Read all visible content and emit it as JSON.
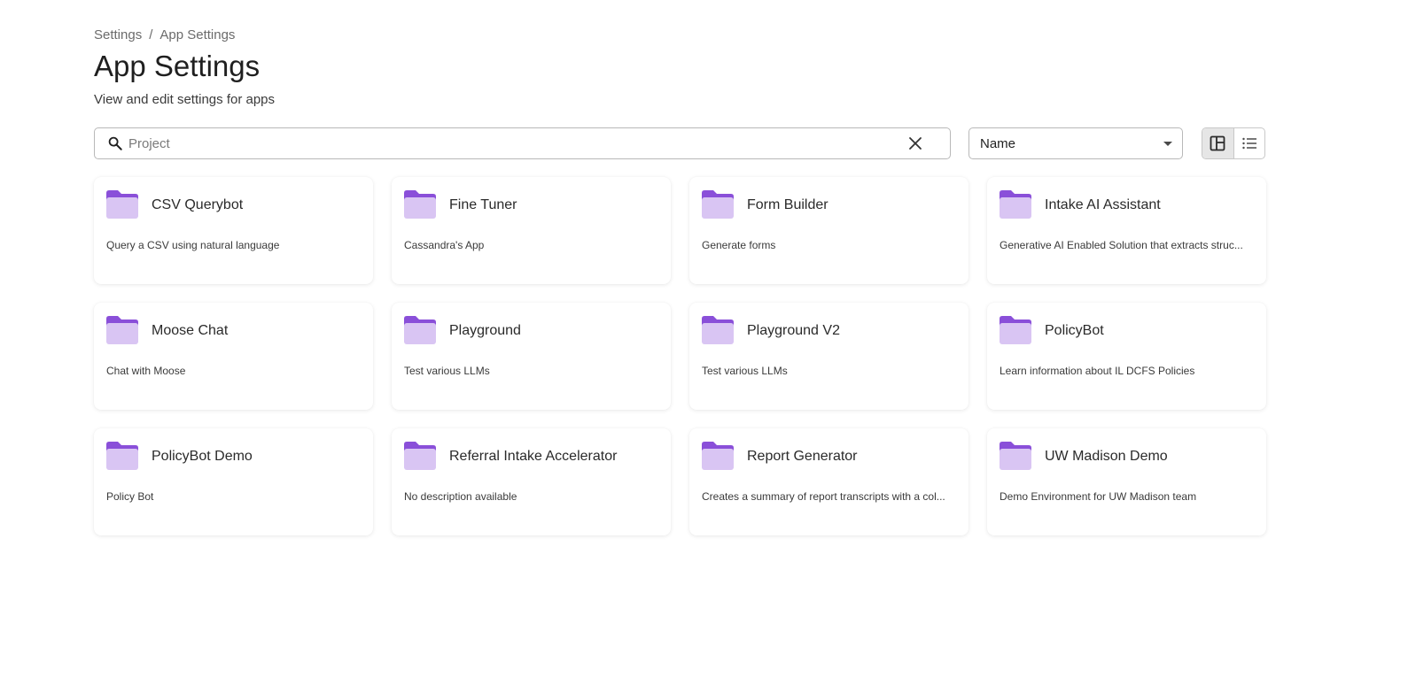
{
  "breadcrumb": {
    "items": [
      "Settings",
      "App Settings"
    ],
    "separator": "/"
  },
  "header": {
    "title": "App Settings",
    "subtitle": "View and edit settings for apps"
  },
  "search": {
    "placeholder": "Project",
    "value": "",
    "icon": "search-icon",
    "clear_icon": "close-icon"
  },
  "sort": {
    "selected": "Name",
    "icon": "caret-down-icon"
  },
  "view_toggle": {
    "active": "grid",
    "options": [
      "grid-view-icon",
      "list-view-icon"
    ]
  },
  "colors": {
    "folder_back": "#8a4fd9",
    "folder_front": "#d9c5f3",
    "accent": "#7c3aed"
  },
  "apps": [
    {
      "name": "CSV Querybot",
      "description": "Query a CSV using natural language"
    },
    {
      "name": "Fine Tuner",
      "description": "Cassandra's App"
    },
    {
      "name": "Form Builder",
      "description": "Generate forms"
    },
    {
      "name": "Intake AI Assistant",
      "description": "Generative AI Enabled Solution that extracts struc..."
    },
    {
      "name": "Moose Chat",
      "description": "Chat with Moose"
    },
    {
      "name": "Playground",
      "description": "Test various LLMs"
    },
    {
      "name": "Playground V2",
      "description": "Test various LLMs"
    },
    {
      "name": "PolicyBot",
      "description": "Learn information about IL DCFS Policies"
    },
    {
      "name": "PolicyBot Demo",
      "description": "Policy Bot"
    },
    {
      "name": "Referral Intake Accelerator",
      "description": "No description available"
    },
    {
      "name": "Report Generator",
      "description": "Creates a summary of report transcripts with a col..."
    },
    {
      "name": "UW Madison Demo",
      "description": "Demo Environment for UW Madison team"
    }
  ]
}
